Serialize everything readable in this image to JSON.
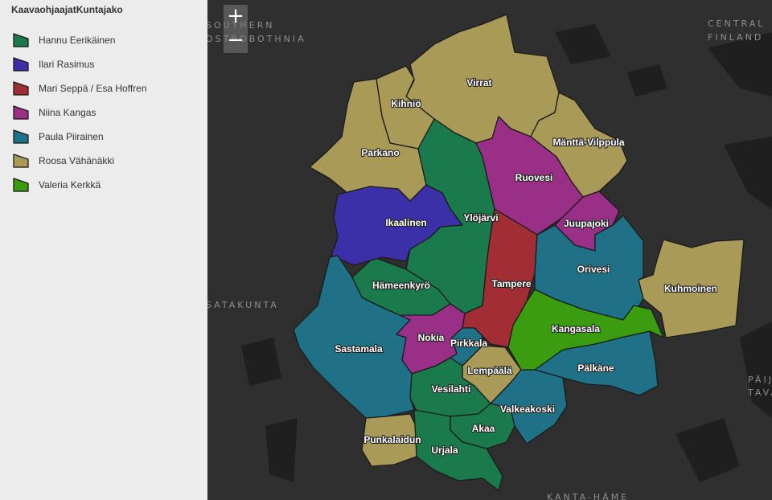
{
  "legend": {
    "title": "KaavaohjaajatKuntajako",
    "items": [
      {
        "label": "Hannu Eerikäinen",
        "color": "#1a7a4c"
      },
      {
        "label": "Ilari Rasimus",
        "color": "#3b30a8"
      },
      {
        "label": "Mari Seppä / Esa Hoffren",
        "color": "#a12d35"
      },
      {
        "label": "Niina Kangas",
        "color": "#9a2f88"
      },
      {
        "label": "Paula Piirainen",
        "color": "#1f7187"
      },
      {
        "label": "Roosa Vähänäkki",
        "color": "#a99a58"
      },
      {
        "label": "Valeria Kerkkä",
        "color": "#3a9c0f"
      }
    ]
  },
  "zoom": {
    "in_label": "+",
    "out_label": "−"
  },
  "regions": {
    "southern_ostrobothnia_1": "SOUTHERN",
    "southern_ostrobothnia_2": "OSTROBOTHNIA",
    "central_finland_1": "CENTRAL",
    "central_finland_2": "FINLAND",
    "satakunta": "SATAKUNTA",
    "paijat_1": "PÄIJ",
    "paijat_2": "TAVA",
    "kanta_hame": "KANTA-HÄME"
  },
  "municipalities": {
    "virrat": "Virrat",
    "kihnio": "Kihniö",
    "parkano": "Parkano",
    "manttavilppula": "Mänttä-Vilppula",
    "ruovesi": "Ruovesi",
    "ylojarvi": "Ylöjärvi",
    "ikaalinen": "Ikaalinen",
    "juupajoki": "Juupajoki",
    "orivesi": "Orivesi",
    "kuhmoinen": "Kuhmoinen",
    "hameenkyro": "Hämeenkyrö",
    "tampere": "Tampere",
    "kangasala": "Kangasala",
    "sastamala": "Sastamala",
    "nokia": "Nokia",
    "pirkkala": "Pirkkala",
    "lempaala": "Lempäälä",
    "palkane": "Pälkäne",
    "vesilahti": "Vesilahti",
    "valkeakoski": "Valkeakoski",
    "akaa": "Akaa",
    "punkalaidun": "Punkalaidun",
    "urjala": "Urjala"
  }
}
